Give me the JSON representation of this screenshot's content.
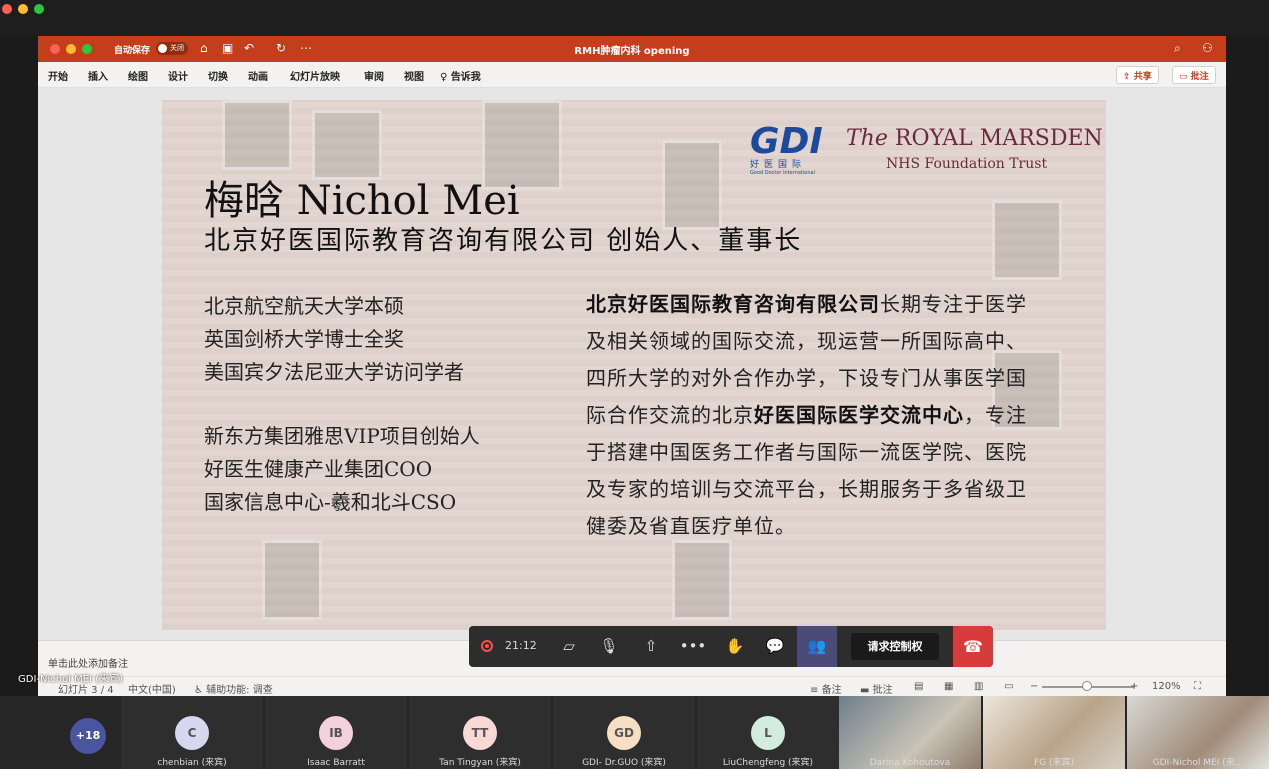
{
  "ppt": {
    "autosave_label": "自动保存",
    "autosave_state": "关闭",
    "doc_title": "RMH肿瘤内科 opening",
    "tabs": [
      "开始",
      "插入",
      "绘图",
      "设计",
      "切换",
      "动画",
      "幻灯片放映",
      "审阅",
      "视图",
      "告诉我"
    ],
    "share_label": "共享",
    "comment_label": "批注",
    "notes_placeholder": "单击此处添加备注",
    "status": {
      "slide": "幻灯片 3 / 4",
      "language": "中文(中国)",
      "accessibility": "辅助功能: 调查",
      "notes": "备注",
      "comments": "批注",
      "zoom": "120%"
    }
  },
  "slide": {
    "name": "梅晗 Nichol Mei",
    "subtitle": "北京好医国际教育咨询有限公司 创始人、董事长",
    "list1": [
      "北京航空航天大学本硕",
      "英国剑桥大学博士全奖",
      "美国宾夕法尼亚大学访问学者"
    ],
    "list2": [
      "新东方集团雅思VIP项目创始人",
      "好医生健康产业集团COO",
      "国家信息中心-羲和北斗CSO"
    ],
    "body_bold1": "北京好医国际教育咨询有限公司",
    "body_text1": "长期专注于医学及相关领域的国际交流，现运营一所国际高中、四所大学的对外合作办学，下设专门从事医学国际合作交流的北京",
    "body_bold2": "好医国际医学交流中心",
    "body_text2": "，专注于搭建中国医务工作者与国际一流医学院、医院及专家的培训与交流平台，长期服务于多省级卫健委及省直医疗单位。",
    "logo_gdi": "GDI",
    "logo_gdi_cn": "好医国际",
    "logo_gdi_en": "Good Doctor International",
    "rm_the": "The",
    "rm_name": "ROYAL MARSDEN",
    "rm_sub": "NHS Foundation Trust"
  },
  "meeting": {
    "presenter_label": "GDI-Nichol MEI (来宾)",
    "record_time": "21:12",
    "request_control": "请求控制权",
    "more_count": "+18",
    "participants": [
      {
        "initials": "C",
        "name": "chenbian (来宾)",
        "color": "#d9d6f0"
      },
      {
        "initials": "IB",
        "name": "Isaac Barratt",
        "color": "#f3d1dc"
      },
      {
        "initials": "TT",
        "name": "Tan Tingyan (来宾)",
        "color": "#f8d9d4"
      },
      {
        "initials": "GD",
        "name": "GDI- Dr.GUO (来宾)",
        "color": "#f6dfc2"
      },
      {
        "initials": "L",
        "name": "LiuChengfeng (来宾)",
        "color": "#d3ece0"
      }
    ],
    "video_participants": [
      {
        "name": "Darina Kohoutova"
      },
      {
        "name": "FG (来宾)"
      },
      {
        "name": "GDI-Nichol MEI (来..."
      }
    ]
  }
}
